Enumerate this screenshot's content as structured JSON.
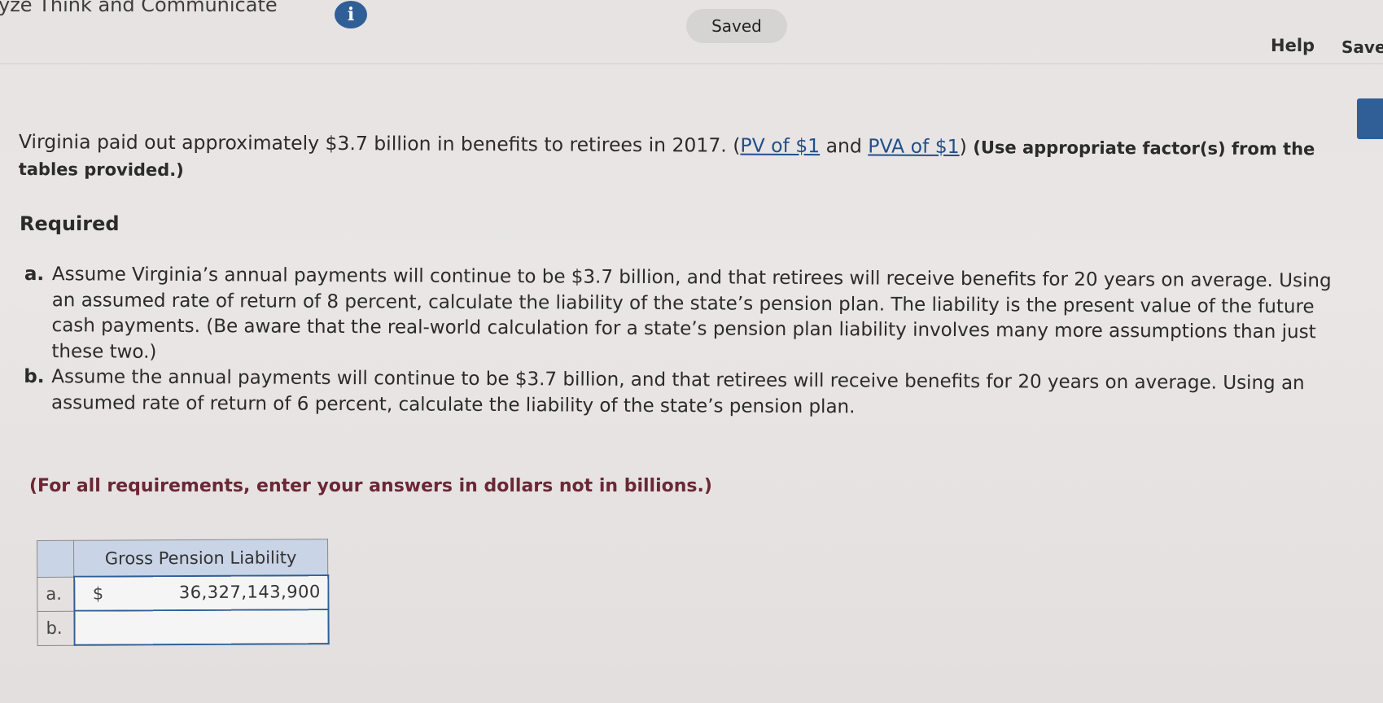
{
  "header": {
    "title": "yze Think and Communicate",
    "info_icon": "i",
    "saved_label": "Saved",
    "help_label": "Help",
    "save_label": "Save"
  },
  "question": {
    "intro_text": "Virginia paid out approximately $3.7 billion in benefits to retirees in 2017. (",
    "pv_link": "PV of $1",
    "and_text": " and ",
    "pva_link": "PVA of $1",
    "close_paren": ") ",
    "instruction": "(Use appropriate factor(s) from the tables provided.)",
    "required_heading": "Required",
    "items": [
      {
        "letter": "a.",
        "text": "Assume Virginia’s annual payments will continue to be $3.7 billion, and that retirees will receive benefits for 20 years on average. Using an assumed rate of return of 8 percent, calculate the liability of the state’s pension plan. The liability is the present value of the future cash payments. (Be aware that the real-world calculation for a state’s pension plan liability involves many more assumptions than just these two.)"
      },
      {
        "letter": "b.",
        "text": "Assume the annual payments will continue to be $3.7 billion, and that retirees will receive benefits for 20 years on average. Using an assumed rate of return of 6 percent, calculate the liability of the state’s pension plan."
      }
    ],
    "note": "(For all requirements, enter your answers in dollars not in billions.)"
  },
  "answer_table": {
    "column_header": "Gross Pension Liability",
    "rows": [
      {
        "label": "a.",
        "currency": "$",
        "value": "36,327,143,900"
      },
      {
        "label": "b.",
        "currency": "",
        "value": ""
      }
    ]
  },
  "colors": {
    "accent_blue": "#2f5f96",
    "table_header": "#c9d4e6",
    "note_text": "#6b2735"
  }
}
